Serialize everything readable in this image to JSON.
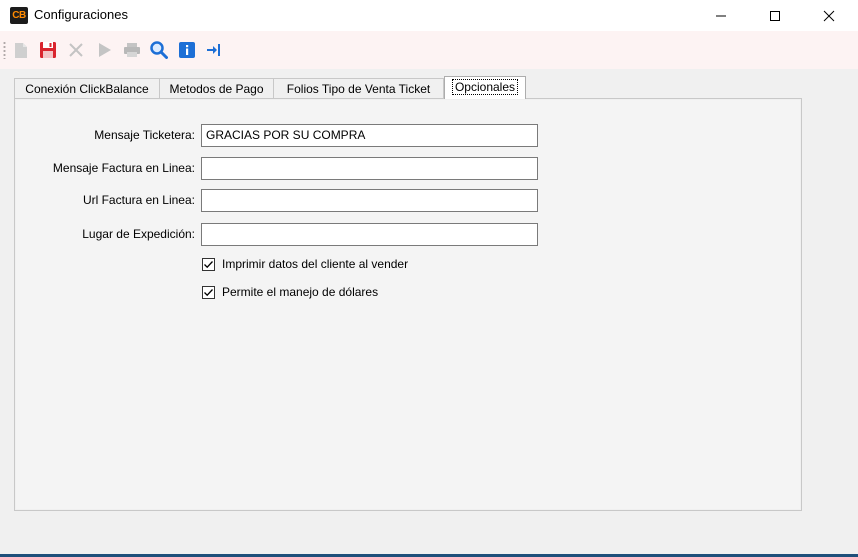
{
  "window": {
    "logo_text": "CB",
    "title": "Configuraciones",
    "controls": {
      "minimize": "—",
      "maximize": "☐",
      "close": "✕"
    }
  },
  "toolbar": {
    "buttons": [
      {
        "name": "new",
        "icon": "new-document-icon",
        "enabled": false
      },
      {
        "name": "save",
        "icon": "save-icon",
        "enabled": true,
        "color": "#d9242e"
      },
      {
        "name": "cancel",
        "icon": "close-icon",
        "enabled": false
      },
      {
        "name": "run",
        "icon": "play-icon",
        "enabled": false
      },
      {
        "name": "print",
        "icon": "printer-icon",
        "enabled": false
      },
      {
        "name": "search",
        "icon": "magnifier-icon",
        "enabled": true,
        "color": "#1d6fd6"
      },
      {
        "name": "info",
        "icon": "info-icon",
        "enabled": true,
        "color": "#1d6fd6"
      },
      {
        "name": "exit",
        "icon": "exit-arrow-icon",
        "enabled": true,
        "color": "#1d6fd6"
      }
    ]
  },
  "tabs": [
    {
      "label": "Conexión ClickBalance",
      "active": false
    },
    {
      "label": "Metodos de Pago",
      "active": false
    },
    {
      "label": "Folios Tipo de Venta Ticket",
      "active": false
    },
    {
      "label": "Opcionales",
      "active": true
    }
  ],
  "form": {
    "fields": [
      {
        "label": "Mensaje Ticketera:",
        "value": "GRACIAS POR SU COMPRA"
      },
      {
        "label": "Mensaje Factura en Linea:",
        "value": ""
      },
      {
        "label": "Url Factura en Linea:",
        "value": ""
      },
      {
        "label": "Lugar de Expedición:",
        "value": ""
      }
    ],
    "checkboxes": [
      {
        "label": "Imprimir datos del cliente al vender",
        "checked": true
      },
      {
        "label": "Permite el manejo de dólares",
        "checked": true
      }
    ]
  },
  "colors": {
    "accent_blue": "#1d6fd6",
    "save_red": "#d9242e",
    "logo_orange": "#ff8a00",
    "bottom_bar": "#1e4f7a"
  }
}
